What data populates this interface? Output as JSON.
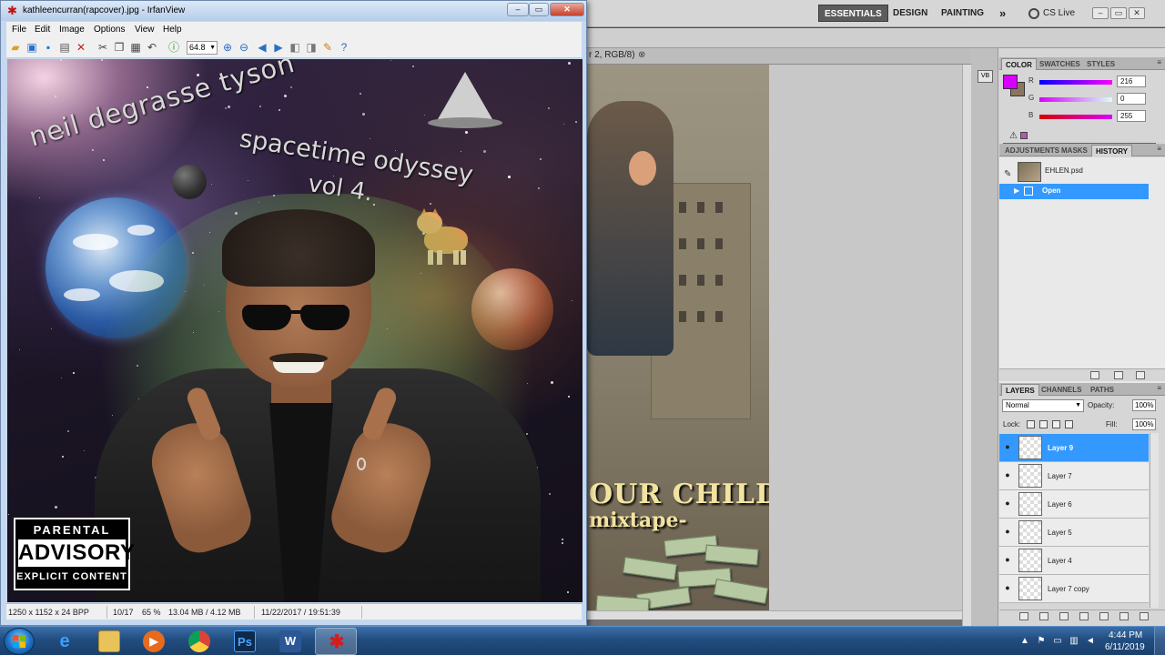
{
  "photoshop": {
    "workspaces": [
      "ESSENTIALS",
      "DESIGN",
      "PAINTING",
      "»"
    ],
    "cs_live": "CS Live",
    "doc_tab": "r 2, RGB/8)",
    "doc_tab_close": "⊗",
    "canvas_title": "OUR CHILDREN",
    "canvas_subtitle": "mixtape-",
    "color_panel": {
      "tabs": [
        "COLOR",
        "SWATCHES",
        "STYLES"
      ],
      "r_label": "R",
      "g_label": "G",
      "b_label": "B",
      "r": "216",
      "g": "0",
      "b": "255",
      "foreground": "#d800ff",
      "background": "#8a7560"
    },
    "history_panel": {
      "tabs": [
        "ADJUSTMENTS",
        "MASKS",
        "HISTORY"
      ],
      "snapshot": "EHLEN.psd",
      "items": [
        "Open"
      ]
    },
    "layers_panel": {
      "tabs": [
        "LAYERS",
        "CHANNELS",
        "PATHS"
      ],
      "blend_mode": "Normal",
      "opacity_label": "Opacity:",
      "opacity": "100%",
      "lock_label": "Lock:",
      "fill_label": "Fill:",
      "fill": "100%",
      "layers": [
        {
          "name": "Layer 9",
          "selected": true
        },
        {
          "name": "Layer 7",
          "selected": false
        },
        {
          "name": "Layer 6",
          "selected": false
        },
        {
          "name": "Layer 5",
          "selected": false
        },
        {
          "name": "Layer 4",
          "selected": false
        },
        {
          "name": "Layer 7 copy",
          "selected": false
        }
      ]
    }
  },
  "irfanview": {
    "title": "kathleencurran(rapcover).jpg - IrfanView",
    "menu": [
      "File",
      "Edit",
      "Image",
      "Options",
      "View",
      "Help"
    ],
    "zoom": "64.8",
    "cover": {
      "artist": "neil degrasse tyson",
      "album": "spacetime odyssey",
      "volume": "vol 4.",
      "advisory_top": "PARENTAL",
      "advisory_mid": "ADVISORY",
      "advisory_bottom": "EXPLICIT CONTENT"
    },
    "status": {
      "dimensions": "1250 x 1152 x 24 BPP",
      "index": "10/17",
      "zoom": "65 %",
      "memory": "13.04 MB / 4.12 MB",
      "datetime": "11/22/2017 / 19:51:39"
    }
  },
  "taskbar": {
    "apps": [
      {
        "name": "Internet Explorer",
        "icon": "ie-icon"
      },
      {
        "name": "Windows Explorer",
        "icon": "folder-icon"
      },
      {
        "name": "Windows Media Player",
        "icon": "media-player-icon"
      },
      {
        "name": "Google Chrome",
        "icon": "chrome-icon"
      },
      {
        "name": "Adobe Photoshop",
        "icon": "photoshop-icon",
        "label": "Ps"
      },
      {
        "name": "Microsoft Word",
        "icon": "word-icon",
        "label": "W"
      },
      {
        "name": "IrfanView",
        "icon": "irfanview-icon",
        "active": true
      }
    ],
    "time": "4:44 PM",
    "date": "6/11/2019"
  }
}
